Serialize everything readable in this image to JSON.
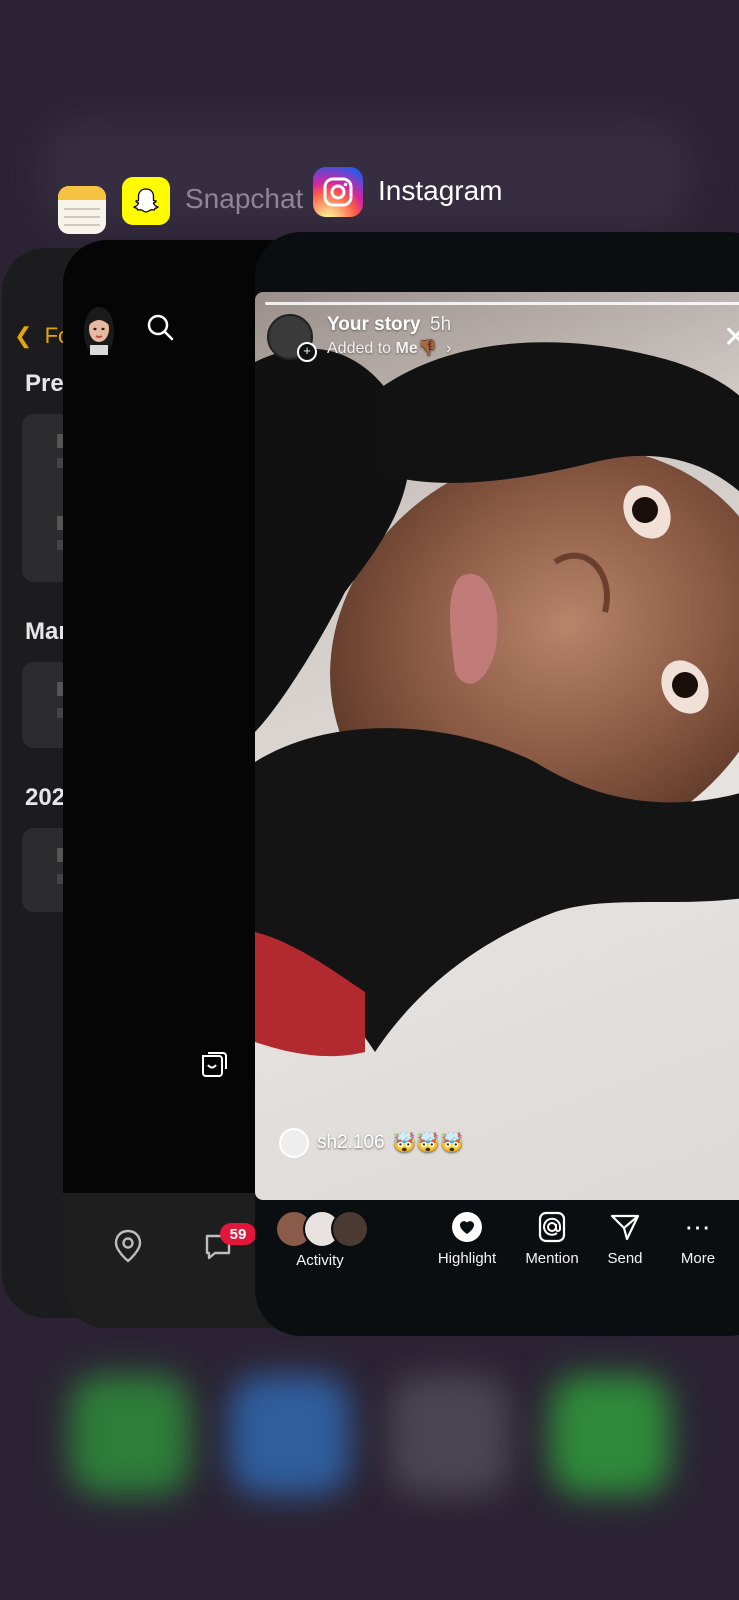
{
  "switcher": {
    "snapchat_label": "Snapchat",
    "instagram_label": "Instagram"
  },
  "notes": {
    "back_label": "Fo",
    "section1": "Pre",
    "section2": "Mar",
    "section3": "202"
  },
  "snapchat": {
    "chat_badge": "59"
  },
  "instagram": {
    "story_user": "Your story",
    "story_time": "5h",
    "added_to_prefix": "Added to ",
    "added_to_list": "Me",
    "added_to_emoji": "👎🏾",
    "mention_user": "sh2.106",
    "mention_emojis": "🤯🤯🤯",
    "actions": {
      "activity": "Activity",
      "highlight": "Highlight",
      "mention": "Mention",
      "send": "Send",
      "more": "More"
    }
  },
  "colors": {
    "notes_accent": "#e5a50a",
    "snapchat_yellow": "#fffc00",
    "badge_red": "#e3163c",
    "background": "#2b2333"
  },
  "icons": [
    "notes-app-icon",
    "snapchat-ghost-icon",
    "instagram-camera-icon",
    "chevron-left-icon",
    "search-icon",
    "map-pin-icon",
    "chat-icon",
    "stories-icon",
    "heart-icon",
    "at-sign-icon",
    "send-icon",
    "more-icon",
    "close-icon",
    "chevron-right-icon"
  ]
}
